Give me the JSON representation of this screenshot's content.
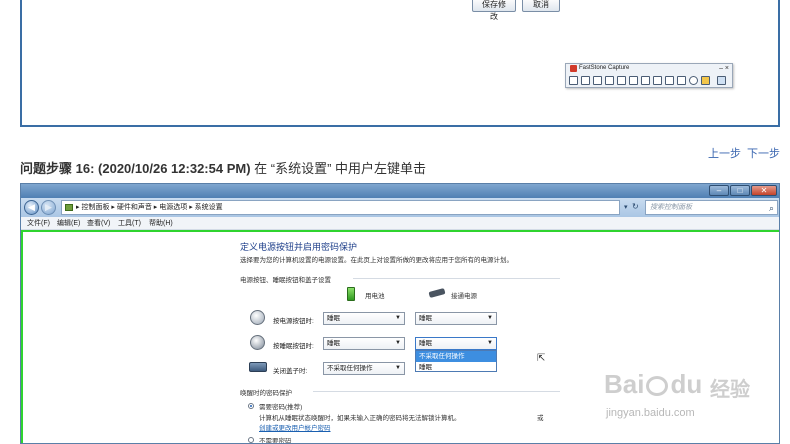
{
  "prev_step": {
    "save_button": "保存修改",
    "cancel_button": "取消",
    "fastcapture": {
      "title": "FastStone Capture",
      "controls": "– ×"
    }
  },
  "nav": {
    "prev": "上一步",
    "next": "下一步"
  },
  "step": {
    "label": "问题步骤",
    "detail": "16: (2020/10/26 12:32:54 PM)",
    "text": "在 “系统设置” 中用户左键单击"
  },
  "window": {
    "controls": {
      "minimize": "–",
      "maximize": "□",
      "close": "✕"
    },
    "address": "▸ 控制面板 ▸ 硬件和声音 ▸ 电源选项 ▸ 系统设置",
    "search_placeholder": "搜索控制面板",
    "menu": [
      "文件(F)",
      "编辑(E)",
      "查看(V)",
      "工具(T)",
      "帮助(H)"
    ],
    "content": {
      "title": "定义电源按钮并启用密码保护",
      "description": "选择要为您的计算机设置的电源设置。在此页上对设置所做的更改将应用于您所有的电源计划。",
      "group1": "电源按钮、睡眠按钮和盖子设置",
      "col_battery": "用电池",
      "col_plugged": "接通电源",
      "rows": [
        {
          "label": "按电源按钮时:",
          "battery": "睡眠",
          "plugged": "睡眠"
        },
        {
          "label": "按睡眠按钮时:",
          "battery": "睡眠",
          "plugged": "睡眠"
        },
        {
          "label": "关闭盖子时:",
          "battery": "不采取任何操作",
          "plugged": ""
        }
      ],
      "dropdown_options": [
        "不采取任何操作",
        "睡眠"
      ],
      "group2": "唤醒时的密码保护",
      "radio1_label": "需要密码(推荐)",
      "radio1_desc": "计算机从睡眠状态唤醒时，如果未输入正确的密码将无法解锁计算机。",
      "radio1_link": "创建或更改用户帐户密码",
      "radio1_link_prefix": "或",
      "radio2_label": "不需要密码"
    }
  },
  "watermark": {
    "brand": "Bai",
    "brand2": "du",
    "cn": "经验",
    "url": "jingyan.baidu.com"
  },
  "colors": {
    "frame_border": "#3a6ea5",
    "highlight_border": "#2fd42f",
    "link": "#3a66b0",
    "dropdown_selected": "#3d8ee0"
  }
}
